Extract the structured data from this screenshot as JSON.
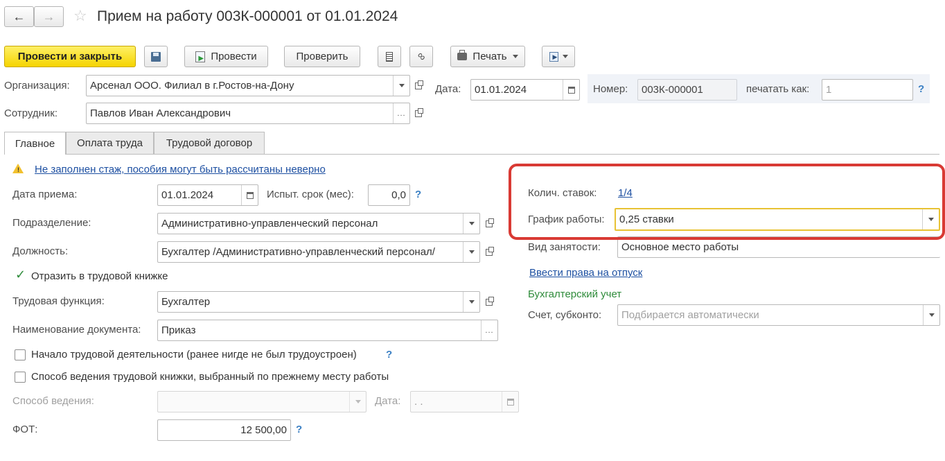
{
  "window": {
    "title": "Прием на работу 003К-000001 от 01.01.2024"
  },
  "toolbar": {
    "post_and_close": "Провести и закрыть",
    "post": "Провести",
    "check": "Проверить",
    "print": "Печать"
  },
  "header": {
    "organization_label": "Организация:",
    "organization_value": "Арсенал ООО. Филиал в г.Ростов-на-Дону",
    "date_label": "Дата:",
    "date_value": "01.01.2024",
    "number_label": "Номер:",
    "number_value": "003К-000001",
    "print_as_label": "печатать как:",
    "print_as_placeholder": "1",
    "employee_label": "Сотрудник:",
    "employee_value": "Павлов Иван Александрович"
  },
  "tabs": [
    {
      "label": "Главное"
    },
    {
      "label": "Оплата труда"
    },
    {
      "label": "Трудовой договор"
    }
  ],
  "main": {
    "warning_text": "Не заполнен стаж, пособия могут быть рассчитаны неверно",
    "hire_date_label": "Дата приема:",
    "hire_date_value": "01.01.2024",
    "probation_label": "Испыт. срок (мес):",
    "probation_value": "0,0",
    "department_label": "Подразделение:",
    "department_value": "Административно-управленческий персонал",
    "position_label": "Должность:",
    "position_value": "Бухгалтер /Административно-управленческий персонал/",
    "reflect_label": "Отразить в трудовой книжке",
    "labor_function_label": "Трудовая функция:",
    "labor_function_value": "Бухгалтер",
    "doc_name_label": "Наименование документа:",
    "doc_name_value": "Приказ",
    "first_job_label": "Начало трудовой деятельности (ранее нигде не был трудоустроен)",
    "book_method_label": "Способ ведения трудовой книжки, выбранный по прежнему месту работы",
    "method_label": "Способ ведения:",
    "method_date_label": "Дата:",
    "method_date_value": " .  .",
    "fot_label": "ФОТ:",
    "fot_value": "12 500,00"
  },
  "right": {
    "rates_label": "Колич. ставок:",
    "rates_value": "1/4",
    "schedule_label": "График работы:",
    "schedule_value": "0,25 ставки",
    "employment_label": "Вид занятости:",
    "employment_value": "Основное место работы",
    "vacation_link": "Ввести права на отпуск",
    "accounting_header": "Бухгалтерский учет",
    "account_label": "Счет, субконто:",
    "account_placeholder": "Подбирается автоматически"
  },
  "colors": {
    "primary_button": "#f5d400",
    "highlight_frame": "#d93a34",
    "focus_border": "#e8c234",
    "link": "#1e50a2",
    "help": "#3a7fc3",
    "section_green": "#2e8b3a"
  }
}
